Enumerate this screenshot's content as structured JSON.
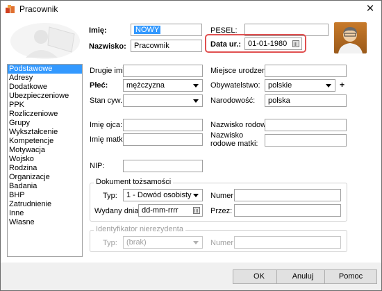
{
  "window": {
    "title": "Pracownik",
    "close_glyph": "✕"
  },
  "header": {
    "imie_label": "Imię:",
    "imie_value": "NOWY",
    "nazwisko_label": "Nazwisko:",
    "nazwisko_value": "Pracownik",
    "pesel_label": "PESEL:",
    "pesel_value": "",
    "data_ur_label": "Data ur.:",
    "data_ur_value": "01-01-1980"
  },
  "sidebar": {
    "items": [
      "Podstawowe",
      "Adresy",
      "Dodatkowe",
      "Ubezpieczeniowe",
      "PPK",
      "Rozliczeniowe",
      "Grupy",
      "Wykształcenie",
      "Kompetencje",
      "Motywacja",
      "Wojsko",
      "Rodzina",
      "Organizacje",
      "Badania",
      "BHP",
      "Zatrudnienie",
      "Inne",
      "Własne"
    ],
    "selected": "Podstawowe"
  },
  "form": {
    "drugie_imie_label": "Drugie imię:",
    "drugie_imie_value": "",
    "plec_label": "Płeć:",
    "plec_value": "mężczyzna",
    "stan_cyw_label": "Stan cyw.:",
    "stan_cyw_value": "",
    "imie_ojca_label": "Imię ojca:",
    "imie_ojca_value": "",
    "imie_matki_label": "Imię matki:",
    "imie_matki_value": "",
    "nip_label": "NIP:",
    "nip_value": "",
    "miejsce_urodzenia_label": "Miejsce urodzenia:",
    "miejsce_urodzenia_value": "",
    "obywatelstwo_label": "Obywatelstwo:",
    "obywatelstwo_value": "polskie",
    "obywatelstwo_add": "+",
    "narodowosc_label": "Narodowość:",
    "narodowosc_value": "polska",
    "nazwisko_rodowe_label": "Nazwisko rodowe:",
    "nazwisko_rodowe_value": "",
    "nazwisko_rodowe_matki_label_1": "Nazwisko",
    "nazwisko_rodowe_matki_label_2": "rodowe matki:",
    "nazwisko_rodowe_matki_value": ""
  },
  "dokument": {
    "title": "Dokument tożsamości",
    "typ_label": "Typ:",
    "typ_value": "1 - Dowód osobisty",
    "numer_label": "Numer:",
    "numer_value": "",
    "wydany_label": "Wydany dnia:",
    "wydany_value": "dd-mm-rrrr",
    "przez_label": "Przez:",
    "przez_value": ""
  },
  "identyfikator": {
    "title": "Identyfikator nierezydenta",
    "typ_label": "Typ:",
    "typ_value": "(brak)",
    "numer_label": "Numer:",
    "numer_value": ""
  },
  "buttons": {
    "ok": "OK",
    "anuluj": "Anuluj",
    "pomoc": "Pomoc"
  }
}
